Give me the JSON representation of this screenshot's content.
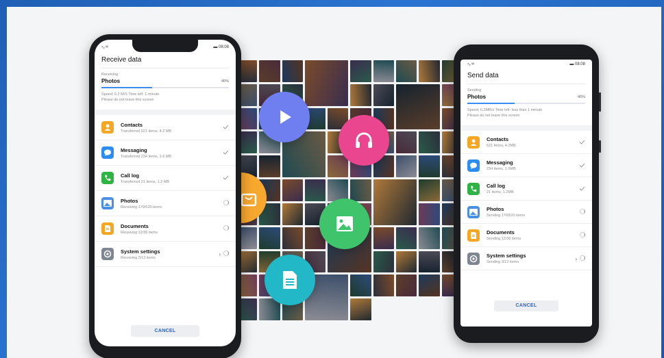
{
  "colors": {
    "accent": "#3b8cf0",
    "cancel_text": "#2a64c6",
    "background_frame": "#1f5fb5"
  },
  "receive_phone": {
    "status_left": "⁴ᵢₗ ᵂ",
    "status_right": "▬ 08:08",
    "title": "Receive data",
    "progress_label": "Receiving",
    "progress_item": "Photos",
    "progress_percent": "40%",
    "progress_value": 0.4,
    "speed_text": "Speed: 6.2 M/S   Time left: 1 minute",
    "note_text": "Please do not leave this screen",
    "items": [
      {
        "name": "Contacts",
        "detail": "Transferred 521 items, 4.2 MB",
        "state": "done",
        "icon": "contacts-icon",
        "color": "#f5a623"
      },
      {
        "name": "Messaging",
        "detail": "Transferred 234 items, 1.6 MB",
        "state": "done",
        "icon": "messaging-icon",
        "color": "#2d8cf0"
      },
      {
        "name": "Call log",
        "detail": "Transferred 21 items, 1.2 MB",
        "state": "done",
        "icon": "call-log-icon",
        "color": "#2fb344"
      },
      {
        "name": "Photos",
        "detail": "Receiving 170/520 items",
        "state": "loading",
        "icon": "photos-icon",
        "color": "#4a90e2"
      },
      {
        "name": "Documents",
        "detail": "Receiving 12/36 items",
        "state": "loading",
        "icon": "documents-icon",
        "color": "#f5a623"
      },
      {
        "name": "System settings",
        "detail": "Receiving 3/12 items",
        "state": "loading-expand",
        "icon": "system-settings-icon",
        "color": "#7d8691"
      }
    ],
    "cancel_label": "CANCEL"
  },
  "send_phone": {
    "status_left": "⁴ᵢₗ ᵂ",
    "status_right": "▬ 08:08",
    "title": "Send data",
    "progress_label": "Sending",
    "progress_item": "Photos",
    "progress_percent": "40%",
    "progress_value": 0.4,
    "speed_text": "Speed: 6.2MB/s   Time left: less than 1 minute",
    "note_text": "Please do not leave this screen",
    "items": [
      {
        "name": "Contacts",
        "detail": "521 items, 4.2MB",
        "state": "done",
        "icon": "contacts-icon",
        "color": "#f5a623"
      },
      {
        "name": "Messaging",
        "detail": "234 items, 1.6MB",
        "state": "done",
        "icon": "messaging-icon",
        "color": "#2d8cf0"
      },
      {
        "name": "Call log",
        "detail": "21 items, 1.2MB",
        "state": "done",
        "icon": "call-log-icon",
        "color": "#2fb344"
      },
      {
        "name": "Photos",
        "detail": "Sending 170/520 items",
        "state": "loading",
        "icon": "photos-icon",
        "color": "#4a90e2"
      },
      {
        "name": "Documents",
        "detail": "Sending 12/36 items",
        "state": "loading",
        "icon": "documents-icon",
        "color": "#f5a623"
      },
      {
        "name": "System settings",
        "detail": "Sending 3/12 items",
        "state": "loading-expand",
        "icon": "system-settings-icon",
        "color": "#7d8691"
      }
    ],
    "cancel_label": "CANCEL"
  },
  "bubbles": [
    {
      "icon": "play-icon",
      "color": "#6f7ff0"
    },
    {
      "icon": "headphones-icon",
      "color": "#e9468f"
    },
    {
      "icon": "shopping-bag-icon",
      "color": "#f7a82f"
    },
    {
      "icon": "image-icon",
      "color": "#3fc46b"
    },
    {
      "icon": "document-icon",
      "color": "#22b8c8"
    }
  ]
}
